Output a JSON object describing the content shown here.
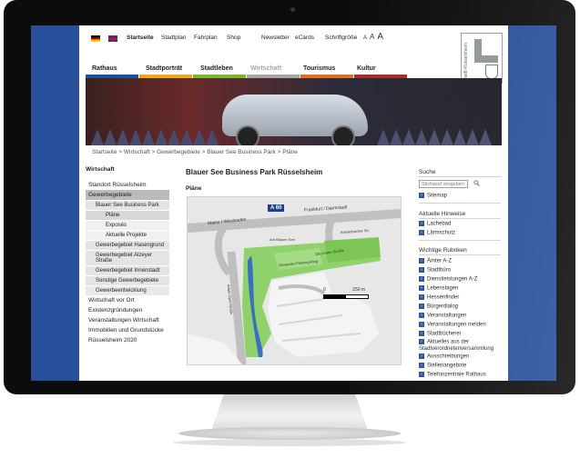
{
  "topnav": {
    "items": [
      "Startseite",
      "Stadtplan",
      "Fahrplan",
      "Shop",
      "Newsletter",
      "eCards",
      "Schriftgröße"
    ],
    "font_sizes": [
      "A",
      "A",
      "A"
    ]
  },
  "logo": {
    "text": "stadt-Rüsselsheim"
  },
  "mainnav": {
    "items": [
      {
        "label": "Rathaus",
        "color": "#1e4f9c"
      },
      {
        "label": "Stadtporträt",
        "color": "#f0a818"
      },
      {
        "label": "Stadtleben",
        "color": "#78b82a"
      },
      {
        "label": "Wirtschaft",
        "color": "#a7a7a7"
      },
      {
        "label": "Tourismus",
        "color": "#e06f1f"
      },
      {
        "label": "Kultur",
        "color": "#a82a28"
      }
    ]
  },
  "breadcrumb": "Startseite > Wirtschaft > Gewerbegebiete > Blauer See Business Park > Pläne",
  "sidebar": {
    "heading": "Wirtschaft",
    "items": [
      "Standort Rüsselsheim",
      "Gewerbegebiete",
      "Blauer See Business Park",
      "Pläne",
      "Exposés",
      "Aktuelle Projekte",
      "Gewerbegebiet Hasengrund",
      "Gewerbegebiet Alzeyer Straße",
      "Gewerbegebiet Innenstadt",
      "Sonstige Gewerbegebiete",
      "Gewerbeentwicklung",
      "Wirtschaft vor Ort",
      "Existenzgründungen",
      "Veranstaltungen Wirtschaft",
      "Immobilien und Grundstücke",
      "Rüsselsheim 2020"
    ]
  },
  "content": {
    "title": "Blauer See Business Park Rüsselsheim",
    "subtitle": "Pläne"
  },
  "map": {
    "labels": [
      "Mainz / Wiesbaden",
      "A 60",
      "Frankfurt / Darmstadt",
      "Am Blauen See",
      "Alexander-Fleming-Ring",
      "Otto-Hahn-Straße",
      "Kelsterbacher Str.",
      "Adam-Opel-Straße"
    ],
    "scale": {
      "unit": "m",
      "min": "0",
      "max": "250"
    }
  },
  "right": {
    "search_heading": "Suche",
    "search_placeholder": "Stichwort eingeben",
    "sitemap": "Sitemap",
    "notices_heading": "Aktuelle Hinweise",
    "notices": [
      "Lachebad",
      "Lärmschutz"
    ],
    "rubrics_heading": "Wichtige Rubriken",
    "rubrics": [
      "Ämter A-Z",
      "Stadtbüro",
      "Dienstleistungen A-Z",
      "Lebenslagen",
      "Hessenfinder",
      "Bürgerdialog",
      "Veranstaltungen",
      "Veranstaltungen melden",
      "Stadtbücherei",
      "Aktuelles aus der Stadtverordnetenversammlung",
      "Ausschreibungen",
      "Stellenangebote",
      "Telefonzentrale Rathaus"
    ]
  }
}
